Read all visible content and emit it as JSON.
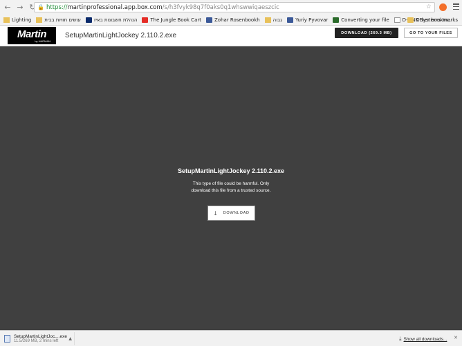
{
  "browser": {
    "url": {
      "protocol": "https://",
      "host": "martinprofessional.app.box.com",
      "path": "/s/h3fvyk98q7f0aks0q1whswwiqaeszcic"
    },
    "bookmarks": [
      {
        "label": "Lighting",
        "icon": "folder-icon",
        "color": "#e8c15a"
      },
      {
        "label": "עושים חוויות בבית",
        "icon": "folder-icon",
        "color": "#e8c15a"
      },
      {
        "label": "הנהלת חשבונות באיז",
        "icon": "a-logo-icon",
        "color": "#0a2a6b"
      },
      {
        "label": "The Jungle Book Cart",
        "icon": "youtube-icon",
        "color": "#e52d27"
      },
      {
        "label": "Zohar Rosenbookh",
        "icon": "facebook-icon",
        "color": "#3b5998"
      },
      {
        "label": "גבוה",
        "icon": "folder-icon",
        "color": "#e8c15a"
      },
      {
        "label": "Yuriy Pyvovar",
        "icon": "facebook-icon",
        "color": "#3b5998"
      },
      {
        "label": "Converting your file",
        "icon": "app-icon",
        "color": "#2b6b2b"
      },
      {
        "label": "D-LINK Systems Inc.",
        "icon": "page-icon",
        "color": "#ffffff"
      }
    ],
    "other_bookmarks": "Other bookmarks"
  },
  "header": {
    "logo_text": "Martin",
    "logo_sub": "by HARMAN",
    "file_name": "SetupMartinLightJockey 2.110.2.exe",
    "download_button": "DOWNLOAD (269.3 MB)",
    "goto_button": "GO TO YOUR FILES"
  },
  "preview": {
    "title": "SetupMartinLightJockey 2.110.2.exe",
    "line1": "This type of file could be harmful. Only",
    "line2": "download this file from a trusted source.",
    "download_button": "DOWNLOAD"
  },
  "download_shelf": {
    "file_name": "SetupMartinLightJoc....exe",
    "status": "11.5/269 MB, 2 mins left",
    "show_all": "Show all downloads..."
  }
}
